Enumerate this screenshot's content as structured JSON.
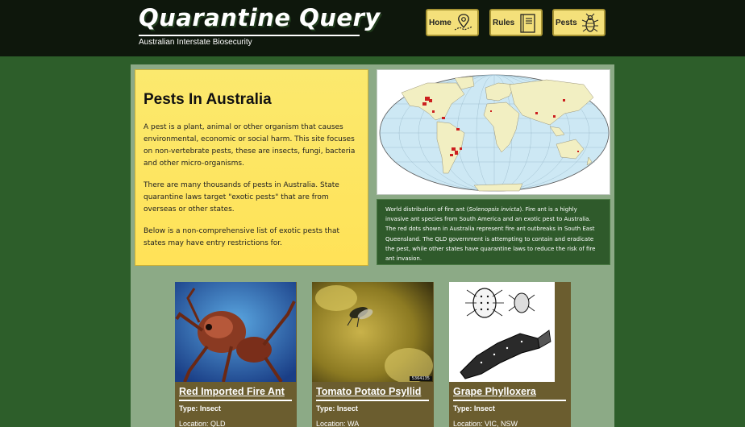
{
  "header": {
    "logo": "Quarantine Query",
    "tagline": "Australian Interstate Biosecurity",
    "nav": [
      {
        "label": "Home",
        "icon": "map-pin-icon"
      },
      {
        "label": "Rules",
        "icon": "book-icon"
      },
      {
        "label": "Pests",
        "icon": "bug-icon"
      }
    ]
  },
  "intro": {
    "title": "Pests In Australia",
    "p1": "A pest is a plant, animal or other organism that causes environmental, economic or social harm. This site focuses on non-vertebrate pests, these are insects, fungi, bacteria and other micro-organisms.",
    "p2": "There are many thousands of pests in Australia. State quarantine laws target \"exotic pests\" that are from overseas or other states.",
    "p3": "Below is a non-comprehensive list of exotic pests that states may have entry restrictions for."
  },
  "map": {
    "icon": "world-map-image",
    "caption_before": "World distribution of fire ant (",
    "caption_species": "Solenopsis invicta",
    "caption_after": "). Fire ant is a highly invasive ant species from South America and an exotic pest to Australia. The red dots shown in Australia represent fire ant outbreaks in South East Queensland. The QLD government is attempting to contain and eradicate the pest, while other states have quarantine laws to reduce the risk of fire ant invasion."
  },
  "pests": [
    {
      "name": "Red Imported Fire Ant",
      "type": "Type: Insect",
      "location": "Location: QLD",
      "icon": "fire-ant-photo"
    },
    {
      "name": "Tomato Potato Psyllid",
      "type": "Type: Insect",
      "location": "Location: WA",
      "icon": "psyllid-photo",
      "badge": "5364135"
    },
    {
      "name": "Grape Phylloxera",
      "type": "Type: Insect",
      "location": "Location: VIC, NSW",
      "icon": "phylloxera-illustration"
    }
  ],
  "colors": {
    "background": "#2d5e2a",
    "topbar": "#0e170c",
    "panel": "#8caa86",
    "intro": "#ffe257",
    "nav_button": "#f4e07a",
    "card": "#6b5d2f",
    "caption": "#2f5a2b"
  }
}
